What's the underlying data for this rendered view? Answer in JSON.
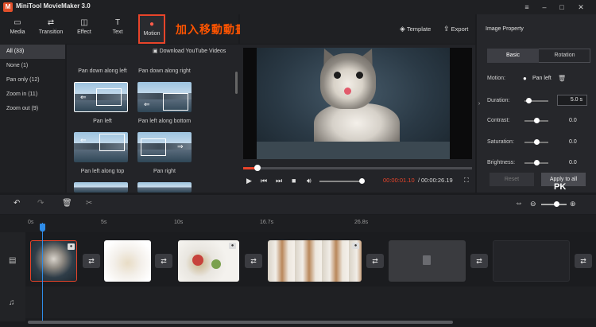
{
  "app": {
    "title": "MiniTool MovieMaker 3.0",
    "logo_letter": "M"
  },
  "window_controls": [
    "≡",
    "–",
    "□",
    "✕"
  ],
  "toolbar": [
    {
      "label": "Media",
      "icon": "folder-icon",
      "glyph": "▭"
    },
    {
      "label": "Transition",
      "icon": "transition-icon",
      "glyph": "⇄"
    },
    {
      "label": "Effect",
      "icon": "effect-icon",
      "glyph": "◫"
    },
    {
      "label": "Text",
      "icon": "text-icon",
      "glyph": "T"
    },
    {
      "label": "Motion",
      "icon": "motion-icon",
      "glyph": "●"
    }
  ],
  "annotation": "加入移動動畫",
  "template_label": "Template",
  "export_label": "Export",
  "categories": [
    "All (33)",
    "None (1)",
    "Pan only (12)",
    "Zoom in (11)",
    "Zoom out (9)"
  ],
  "download_label": "Download YouTube Videos",
  "gallery": {
    "partial_labels": [
      "Pan down along left",
      "Pan down along right"
    ],
    "items": [
      "Pan left",
      "Pan left along bottom",
      "Pan left along top",
      "Pan right"
    ]
  },
  "player": {
    "current_time": "00:00:01.10",
    "separator": " / ",
    "total_time": "00:00:26.19",
    "progress": 0.04,
    "volume": 0.9
  },
  "properties": {
    "title": "Image Property",
    "tabs": [
      "Basic",
      "Rotation"
    ],
    "motion_label": "Motion:",
    "motion_value": "Pan left",
    "rows": [
      {
        "label": "Duration:",
        "value": "5.0 s"
      },
      {
        "label": "Contrast:",
        "value": "0.0"
      },
      {
        "label": "Saturation:",
        "value": "0.0"
      },
      {
        "label": "Brightness:",
        "value": "0.0"
      }
    ],
    "reset_label": "Reset",
    "apply_label": "Apply to all",
    "watermark": "PK"
  },
  "timeline": {
    "ruler": [
      "0s",
      "5s",
      "10s",
      "16.7s",
      "26.8s"
    ],
    "zoom": 0.55
  }
}
